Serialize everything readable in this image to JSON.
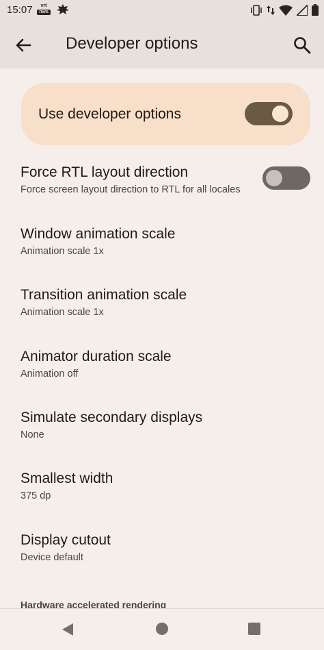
{
  "status_bar": {
    "time": "15:07",
    "badge_top": "vrt",
    "badge_bottom": "nws",
    "icons": [
      "vibrate-icon",
      "data-arrows-icon",
      "wifi-icon",
      "cell-signal-icon",
      "battery-icon"
    ]
  },
  "app_bar": {
    "title": "Developer options",
    "back_icon": "arrow-back-icon",
    "search_icon": "search-icon"
  },
  "main_switch": {
    "label": "Use developer options",
    "enabled": true
  },
  "settings": [
    {
      "title": "Force RTL layout direction",
      "subtitle": "Force screen layout direction to RTL for all locales",
      "toggle": false
    },
    {
      "title": "Window animation scale",
      "subtitle": "Animation scale 1x"
    },
    {
      "title": "Transition animation scale",
      "subtitle": "Animation scale 1x"
    },
    {
      "title": "Animator duration scale",
      "subtitle": "Animation off"
    },
    {
      "title": "Simulate secondary displays",
      "subtitle": "None"
    },
    {
      "title": "Smallest width",
      "subtitle": "375 dp"
    },
    {
      "title": "Display cutout",
      "subtitle": "Device default"
    }
  ],
  "section_header": "Hardware accelerated rendering",
  "nav_bar": {
    "buttons": [
      "nav-back-icon",
      "nav-home-icon",
      "nav-recents-icon"
    ]
  },
  "colors": {
    "background": "#f6eeeb",
    "app_bar": "#e8e0dd",
    "card": "#f7dfc9",
    "toggle_on": "#6a5a45",
    "toggle_off": "#6e6762"
  }
}
